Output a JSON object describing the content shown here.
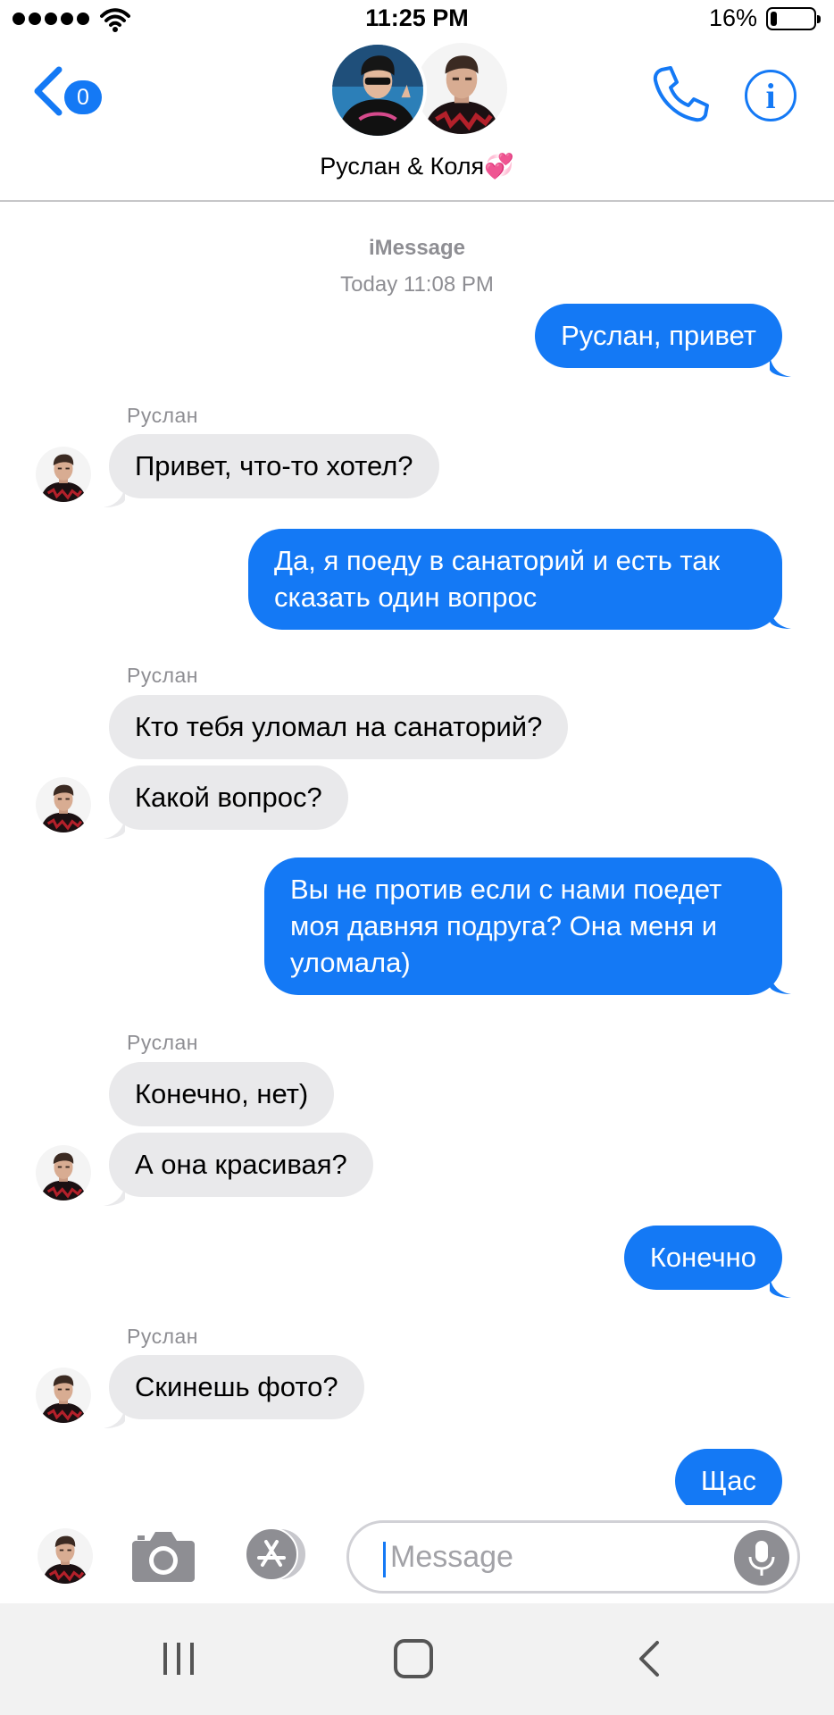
{
  "status_bar": {
    "time": "11:25 PM",
    "battery_percent": "16%",
    "battery_level": 0.16,
    "signal_bars": 5
  },
  "header": {
    "back_badge": "0",
    "contact_name": "Руслан & Коля💞"
  },
  "conversation": {
    "service": "iMessage",
    "timestamp": "Today 11:08 PM",
    "messages": [
      {
        "direction": "out",
        "text": "Руслан, привет"
      },
      {
        "direction": "in",
        "sender": "Руслан",
        "text": "Привет, что-то хотел?"
      },
      {
        "direction": "out",
        "text": "Да, я поеду в санаторий и есть так сказать один вопрос"
      },
      {
        "direction": "in",
        "sender": "Руслан",
        "text": "Кто тебя уломал на санаторий?"
      },
      {
        "direction": "in",
        "text": "Какой вопрос?"
      },
      {
        "direction": "out",
        "text": "Вы не против если с нами поедет моя давняя подруга? Она меня и уломала)"
      },
      {
        "direction": "in",
        "sender": "Руслан",
        "text": "Конечно, нет)"
      },
      {
        "direction": "in",
        "text": "А она красивая?"
      },
      {
        "direction": "out",
        "text": "Конечно"
      },
      {
        "direction": "in",
        "sender": "Руслан",
        "text": "Скинешь фото?"
      },
      {
        "direction": "out",
        "text": "Щас"
      }
    ]
  },
  "input_bar": {
    "placeholder": "Message"
  },
  "icons": {
    "back": "chevron-left-icon",
    "call": "phone-icon",
    "info": "info-icon",
    "camera": "camera-icon",
    "apps": "app-store-icon",
    "mic": "microphone-icon"
  },
  "colors": {
    "accent": "#1479f5",
    "incoming_bubble": "#e9e9eb",
    "meta_text": "#8e8e93"
  }
}
